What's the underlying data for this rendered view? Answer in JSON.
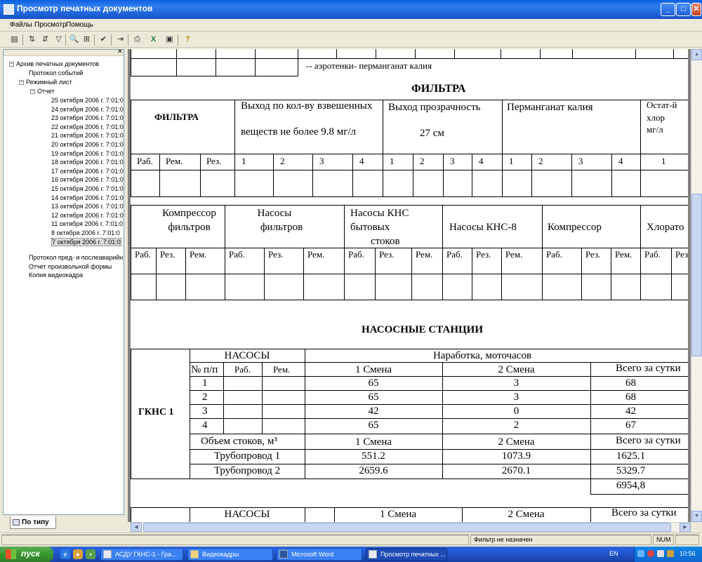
{
  "window": {
    "title": "Просмотр печатных документов",
    "min": "_",
    "max": "□",
    "close": "✕"
  },
  "menu": [
    "Файлы",
    "Просмотр",
    "Помощь"
  ],
  "tree": {
    "root": "Архив печатных документов",
    "events": "Протокол событий",
    "mode_sheet": "Режимный лист",
    "report": "Отчет",
    "dates": [
      "25 октября 2006 г. 7:01:0",
      "24 октября 2006 г. 7:01:0",
      "23 октября 2006 г. 7:01:0",
      "22 октября 2006 г. 7:01:0",
      "21 октября 2006 г. 7:01:0",
      "20 октября 2006 г. 7:01:0",
      "19 октября 2006 г. 7:01:0",
      "18 октября 2006 г. 7:01:0",
      "17 октября 2006 г. 7:01:0",
      "16 октября 2006 г. 7:01:0",
      "15 октября 2006 г. 7:01:0",
      "14 октября 2006 г. 7:01:0",
      "13 октября 2006 г. 7:01:0",
      "12 октября 2006 г. 7:01:0",
      "11 октября 2006 г. 7:01:0",
      "8 октября 2006 г. 7:01:0",
      "7 октября 2006 г. 7:01:0"
    ],
    "pre_post": "Протокол пред- и послеаварийн",
    "custom": "Отчет произвольной формы",
    "video_copy": "Копия видеокадра"
  },
  "left_tab": "По типу",
  "doc": {
    "aero_line": "--  аэротенки-   перманганат калия",
    "filters_title": "ФИЛЬТРА",
    "filters_head": {
      "col1": "ФИЛЬТРА",
      "col2a": "Выход по кол-ву взвешенных",
      "col2b": "веществ не более 9.8 мг/л",
      "col3a": "Выход прозрачность",
      "col3b": "27 см",
      "col4": "Перманганат калия",
      "col5a": "Остат-й",
      "col5b": "хлор",
      "col5c": "мг/л"
    },
    "filters_sub": [
      "Раб.",
      "Рем.",
      "Рез.",
      "1",
      "2",
      "3",
      "4",
      "1",
      "2",
      "3",
      "4",
      "1",
      "2",
      "3",
      "4",
      "1"
    ],
    "pumps_head": {
      "g1a": "Компрессор",
      "g1b": "фильтров",
      "g2a": "Насосы",
      "g2b": "фильтров",
      "g3a": "Насосы КНС",
      "g3b": "бытовых",
      "g3c": "стоков",
      "g4": "Насосы КНС-8",
      "g5": "Компрессор",
      "g6": "Хлорато"
    },
    "pumps_sub": [
      "Раб.",
      "Рез.",
      "Рем.",
      "Раб.",
      "Рез.",
      "Рем.",
      "Раб.",
      "Рез.",
      "Рем.",
      "Раб.",
      "Рез.",
      "Рем.",
      "Раб.",
      "Рез.",
      "Рем.",
      "Раб.",
      "Рез"
    ],
    "stations_title": "НАСОСНЫЕ   СТАНЦИИ",
    "gkns": {
      "label": "ГКНС 1",
      "pumps": "НАСОСЫ",
      "hours": "Наработка, моточасов",
      "np": "№ п/п",
      "rab": "Раб.",
      "rem": "Рем.",
      "shift1": "1 Смена",
      "shift2": "2 Смена",
      "total": "Всего за  сутки",
      "rows": [
        {
          "n": "1",
          "s1": "65",
          "s2": "3",
          "t": "68"
        },
        {
          "n": "2",
          "s1": "65",
          "s2": "3",
          "t": "68"
        },
        {
          "n": "3",
          "s1": "42",
          "s2": "0",
          "t": "42"
        },
        {
          "n": "4",
          "s1": "65",
          "s2": "2",
          "t": "67"
        }
      ],
      "volume": "Объем  стоков, м³",
      "pipes": [
        {
          "name": "Трубопровод 1",
          "s1": "551.2",
          "s2": "1073.9",
          "t": "1625.1"
        },
        {
          "name": "Трубопровод 2",
          "s1": "2659.6",
          "s2": "2670.1",
          "t": "5329.7"
        }
      ],
      "grand_total": "6954,8"
    },
    "next_block": {
      "pumps": "НАСОСЫ",
      "shift1": "1 Смена",
      "shift2": "2 Смена",
      "total": "Всего за  сутки"
    }
  },
  "status": {
    "filter": "Фильтр не назначен",
    "num": "NUM"
  },
  "taskbar": {
    "start": "пуск",
    "tasks": [
      "АСДУ ГКНС-1 - Гра...",
      "Видеокадры",
      "Microsoft Word",
      "Просмотр печатных ..."
    ],
    "lang": "EN",
    "clock": "10:56"
  }
}
